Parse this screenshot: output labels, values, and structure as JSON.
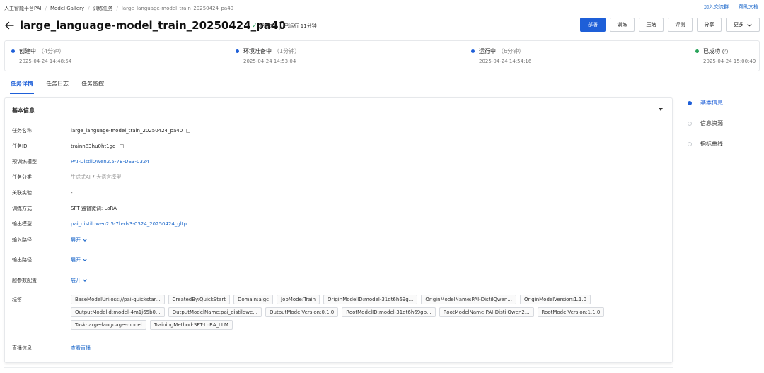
{
  "breadcrumb": [
    {
      "label": "人工智能平台PAI"
    },
    {
      "label": "Model Gallery"
    },
    {
      "label": "训练任务"
    },
    {
      "label": "large_language-model_train_20250424_pa40"
    }
  ],
  "top_links": {
    "join_group": "加入交流群",
    "help_docs": "帮助文档"
  },
  "header": {
    "title": "large_language-model_train_20250424_pa40",
    "status": "已成功",
    "running_time": "已运行 11分钟"
  },
  "actions": {
    "deploy": "部署",
    "train": "训练",
    "compress": "压缩",
    "evaluate": "评测",
    "share": "分享",
    "more": "更多"
  },
  "timeline": [
    {
      "name": "创建中",
      "duration": "（4分钟）",
      "time": "2025-04-24 14:48:54",
      "color": "blue"
    },
    {
      "name": "环境准备中",
      "duration": "（1分钟）",
      "time": "2025-04-24 14:53:04",
      "color": "blue"
    },
    {
      "name": "运行中",
      "duration": "（6分钟）",
      "time": "2025-04-24 14:54:16",
      "color": "blue"
    },
    {
      "name": "已成功",
      "duration": "",
      "time": "2025-04-24 15:00:49",
      "color": "green"
    }
  ],
  "tabs": [
    {
      "label": "任务详情"
    },
    {
      "label": "任务日志"
    },
    {
      "label": "任务监控"
    }
  ],
  "basic_info": {
    "title": "基本信息",
    "fields": {
      "task_name": {
        "label": "任务名称",
        "value": "large_language-model_train_20250424_pa40"
      },
      "task_id": {
        "label": "任务ID",
        "value": "trainn83hu0ht1gq"
      },
      "pretrained_model": {
        "label": "预训练模型",
        "value": "PAI-DistilQwen2.5-7B-DS3-0324"
      },
      "task_category": {
        "label": "任务分类",
        "value_a": "生成式AI",
        "slash": "/",
        "value_b": "大语言模型"
      },
      "related_experiment": {
        "label": "关联实验",
        "value": "-"
      },
      "training_method": {
        "label": "训练方式",
        "value": "SFT 监督微调: LoRA"
      },
      "output_model": {
        "label": "输出模型",
        "value": "pai_distilqwen2.5-7b-ds3-0324_20250424_gltp"
      },
      "input_path": {
        "label": "输入路径",
        "value": "展开"
      },
      "output_path": {
        "label": "输出路径",
        "value": "展开"
      },
      "hyperparams": {
        "label": "超参数配置",
        "value": "展开"
      },
      "tags_label": "标签",
      "live_info": {
        "label": "直播信息",
        "value": "查看直播"
      }
    },
    "tags": [
      "BaseModelUri:oss://pai-quickstar...",
      "CreatedBy:QuickStart",
      "Domain:aigc",
      "JobMode:Train",
      "OriginModelID:model-31dt6h69g...",
      "OriginModelName:PAI-DistilQwen...",
      "OriginModelVersion:1.1.0",
      "OutputModelId:model-4m1j65b0...",
      "OutputModelName:pai_distilqwe...",
      "OutputModelVersion:0.1.0",
      "RootModelID:model-31dt6h69gb...",
      "RootModelName:PAI-DistilQwen2...",
      "RootModelVersion:1.1.0",
      "Task:large-language-model",
      "TrainingMethod:SFT:LoRA_LLM"
    ]
  },
  "anchor_nav": [
    {
      "label": "基本信息"
    },
    {
      "label": "信息资源"
    },
    {
      "label": "指标曲线"
    }
  ],
  "colors": {
    "primary": "#1e5fd8",
    "link": "#1a66c9",
    "success": "#29a35a"
  }
}
